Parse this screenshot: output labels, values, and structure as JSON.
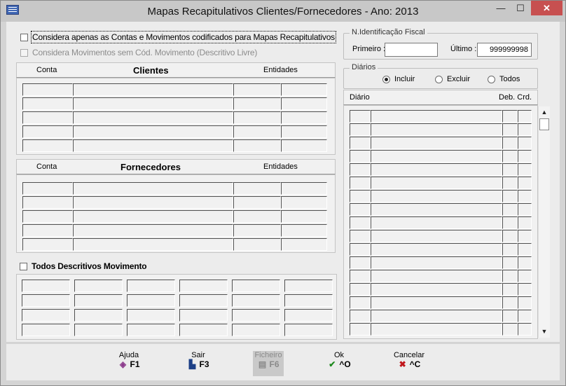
{
  "window": {
    "title": "Mapas Recapitulativos Clientes/Fornecedores - Ano: 2013",
    "minimize": "—",
    "maximize": "☐",
    "close": "✕"
  },
  "options": {
    "codificados": "Considera apenas as Contas e Movimentos codificados para Mapas Recapitulativos",
    "sem_cod": "Considera Movimentos sem Cód. Movimento (Descritivo Livre)",
    "todos_descritivos": "Todos Descritivos Movimento"
  },
  "nif": {
    "group_title": "N.Identificação Fiscal",
    "primeiro_label": "Primeiro :",
    "primeiro_value": "",
    "ultimo_label": "Último :",
    "ultimo_value": "999999998"
  },
  "diarios": {
    "group_title": "Diários",
    "options": [
      "Incluir",
      "Excluir",
      "Todos"
    ],
    "selected": "Incluir"
  },
  "clientes_grid": {
    "col_conta": "Conta",
    "title": "Clientes",
    "col_entidades": "Entidades"
  },
  "fornecedores_grid": {
    "col_conta": "Conta",
    "title": "Fornecedores",
    "col_entidades": "Entidades"
  },
  "diario_grid": {
    "col_diario": "Diário",
    "col_debcrd": "Deb. Crd."
  },
  "footer": {
    "ajuda": {
      "label": "Ajuda",
      "key": "F1"
    },
    "sair": {
      "label": "Sair",
      "key": "F3"
    },
    "ficheiro": {
      "label": "Ficheiro",
      "key": "F6"
    },
    "ok": {
      "label": "Ok",
      "key": "^O"
    },
    "cancelar": {
      "label": "Cancelar",
      "key": "^C"
    }
  },
  "colors": {
    "accent_ok": "#1e8a1e",
    "accent_cancel": "#c0161c"
  }
}
